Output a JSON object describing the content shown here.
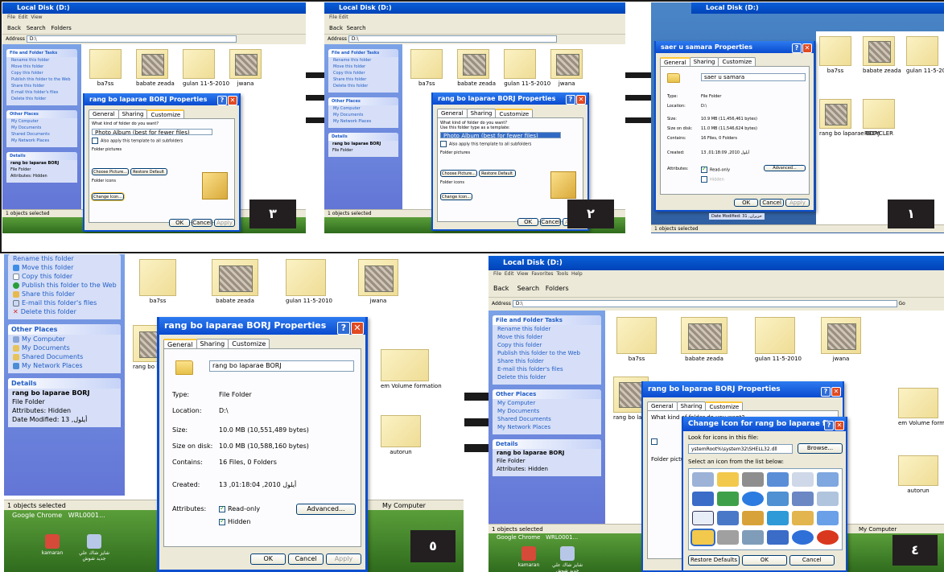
{
  "explorer": {
    "window_title": "Local Disk (D:)",
    "menu": [
      "File",
      "Edit",
      "View",
      "Favorites",
      "Tools",
      "Help"
    ],
    "toolbar": {
      "back": "Back",
      "search": "Search",
      "folders": "Folders"
    },
    "address_label": "Address",
    "address_value": "D:\\",
    "go": "Go",
    "status": "1 objects selected",
    "status_right": "My Computer"
  },
  "tasks": {
    "file_folder_head": "File and Folder Tasks",
    "items": [
      "Rename this folder",
      "Move this folder",
      "Copy this folder",
      "Publish this folder to the Web",
      "Share this folder",
      "E-mail this folder's files",
      "Delete this folder"
    ],
    "other_head": "Other Places",
    "other_items": [
      "My Computer",
      "My Documents",
      "Shared Documents",
      "My Network Places"
    ],
    "details_head": "Details",
    "details_name": "rang bo laparae BORJ",
    "details_type": "File Folder",
    "details_attrs": "Attributes: Hidden",
    "details_date": "Date Modified: 13 ,أيلول"
  },
  "files": [
    "ba7ss",
    "babate zeada",
    "gulan 11-5-2010",
    "jwana",
    "rang bo laparae BORJ",
    "em Volume formation",
    "autorun"
  ],
  "desktop": {
    "taskbar_items": [
      "Google Chrome",
      "WRL0001..."
    ],
    "icons": [
      "kamaran",
      "شايز شاك علي جديد شوش"
    ]
  },
  "general_dialog": {
    "title": "rang bo laparae BORJ Properties",
    "tabs": [
      "General",
      "Sharing",
      "Customize"
    ],
    "name_value": "rang bo laparae BORJ",
    "rows": [
      {
        "k": "Type:",
        "v": "File Folder"
      },
      {
        "k": "Location:",
        "v": "D:\\"
      },
      {
        "k": "Size:",
        "v": "10.0 MB (10,551,489 bytes)"
      },
      {
        "k": "Size on disk:",
        "v": "10.0 MB (10,588,160 bytes)"
      },
      {
        "k": "Contains:",
        "v": "16 Files, 0 Folders"
      },
      {
        "k": "Created:",
        "v": "13 ,أيلول 2010, 01:18:04"
      }
    ],
    "attributes_label": "Attributes:",
    "readonly": "Read-only",
    "hidden": "Hidden",
    "advanced": "Advanced...",
    "ok": "OK",
    "cancel": "Cancel",
    "apply": "Apply"
  },
  "general_dialog_1": {
    "title": "saer u samara Properties",
    "name_value": "saer u samara",
    "rows": [
      {
        "k": "Type:",
        "v": "File Folder"
      },
      {
        "k": "Location:",
        "v": "D:\\"
      },
      {
        "k": "Size:",
        "v": "10.9 MB (11,456,461 bytes)"
      },
      {
        "k": "Size on disk:",
        "v": "11.0 MB (11,546,624 bytes)"
      },
      {
        "k": "Contains:",
        "v": "16 Files, 0 Folders"
      },
      {
        "k": "Created:",
        "v": "13 ,أيلول 2010, 01:18:09"
      }
    ],
    "readonly": "Read-only",
    "hidden": "Hidden",
    "date_modified": "Date Modified: 31 ,حزيران"
  },
  "customize_dialog": {
    "title": "rang bo laparae BORJ Properties",
    "q1": "What kind of folder do you want?",
    "q1_sub": "Use this folder type as a template:",
    "template": "Photo Album (best for fewer files)",
    "also_apply": "Also apply this template to all subfolders",
    "folder_pictures": "Folder pictures",
    "fp_desc": "For Thumbnails view, you can put a picture on this folder to remind you of the contents.",
    "preview": "Preview:",
    "choose_picture": "Choose Picture...",
    "restore_default": "Restore Default",
    "folder_icons": "Folder icons",
    "fi_desc": "For all views except Thumbnails, you can change the standard \"folder\" icon to another icon.",
    "change_icon": "Change Icon..."
  },
  "change_icon_dialog": {
    "title": "Change Icon for rang bo laparae fI...",
    "look_for": "Look for icons in this file:",
    "file_value": "ystemRoot%\\system32\\SHELL32.dll",
    "browse": "Browse...",
    "select_label": "Select an icon from the list below:",
    "restore_defaults": "Restore Defaults",
    "ok": "OK",
    "cancel": "Cancel"
  },
  "step_labels": [
    "١",
    "٢",
    "٣",
    "٤",
    "٥"
  ],
  "colors": {
    "xp_blue": "#0a4bcf",
    "xp_gray": "#ece9d8",
    "label_bg": "#231f20",
    "task_link": "#215dc6"
  }
}
